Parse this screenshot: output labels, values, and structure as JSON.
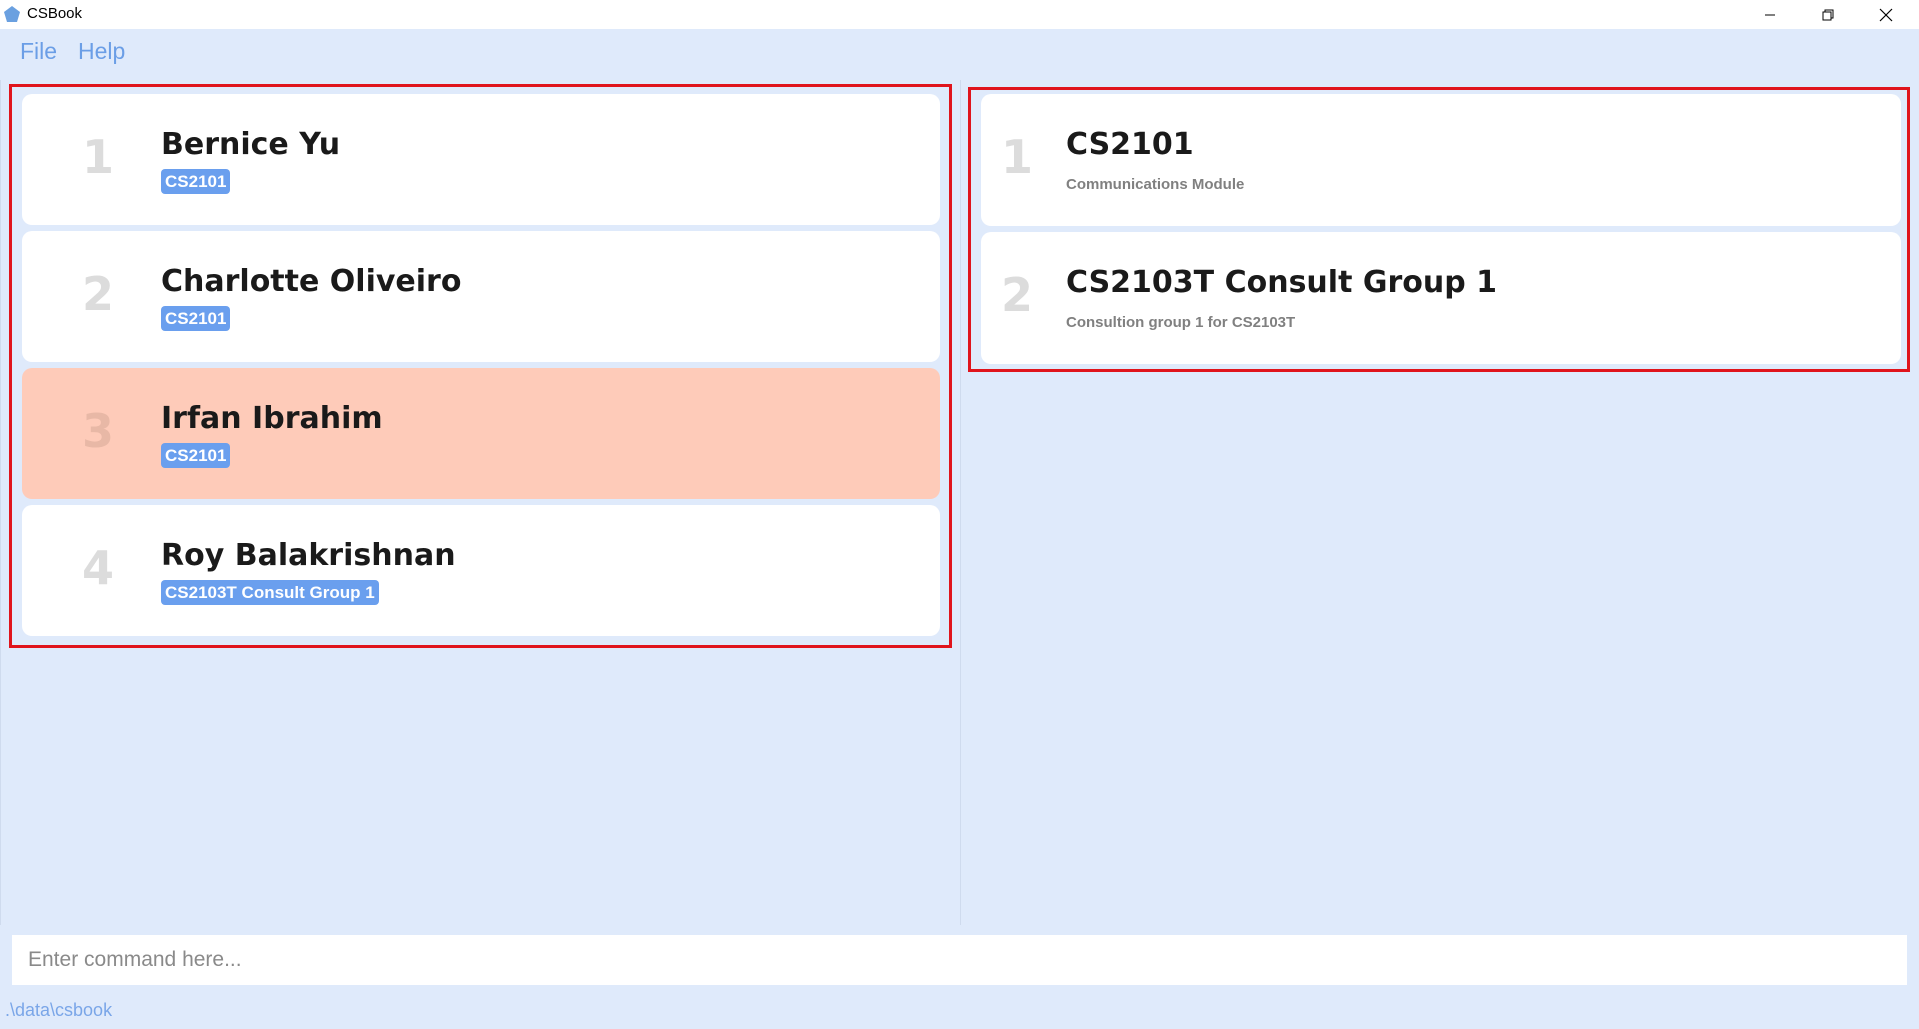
{
  "window": {
    "title": "CSBook",
    "icon": "pentagon-app-icon",
    "controls": [
      "minimize-icon",
      "restore-icon",
      "close-icon"
    ]
  },
  "menu": {
    "file_label": "File",
    "help_label": "Help"
  },
  "students": [
    {
      "index": "1",
      "name": "Bernice Yu",
      "tag": "CS2101",
      "selected": false
    },
    {
      "index": "2",
      "name": "Charlotte Oliveiro",
      "tag": "CS2101",
      "selected": false
    },
    {
      "index": "3",
      "name": "Irfan Ibrahim",
      "tag": "CS2101",
      "selected": true
    },
    {
      "index": "4",
      "name": "Roy Balakrishnan",
      "tag": "CS2103T Consult Group 1",
      "selected": false
    }
  ],
  "groups": [
    {
      "index": "1",
      "name": "CS2101",
      "description": "Communications Module"
    },
    {
      "index": "2",
      "name": "CS2103T Consult Group 1",
      "description": "Consultion group 1 for CS2103T"
    }
  ],
  "command": {
    "placeholder": "Enter command here...",
    "value": ""
  },
  "status": {
    "path": ".\\data\\csbook"
  },
  "colors": {
    "background": "#dfeafb",
    "card": "#ffffff",
    "selected_card": "#fecbb9",
    "tag": "#6a9fee",
    "highlight_border": "#e0141c",
    "menu_text": "#6b9ee6"
  }
}
